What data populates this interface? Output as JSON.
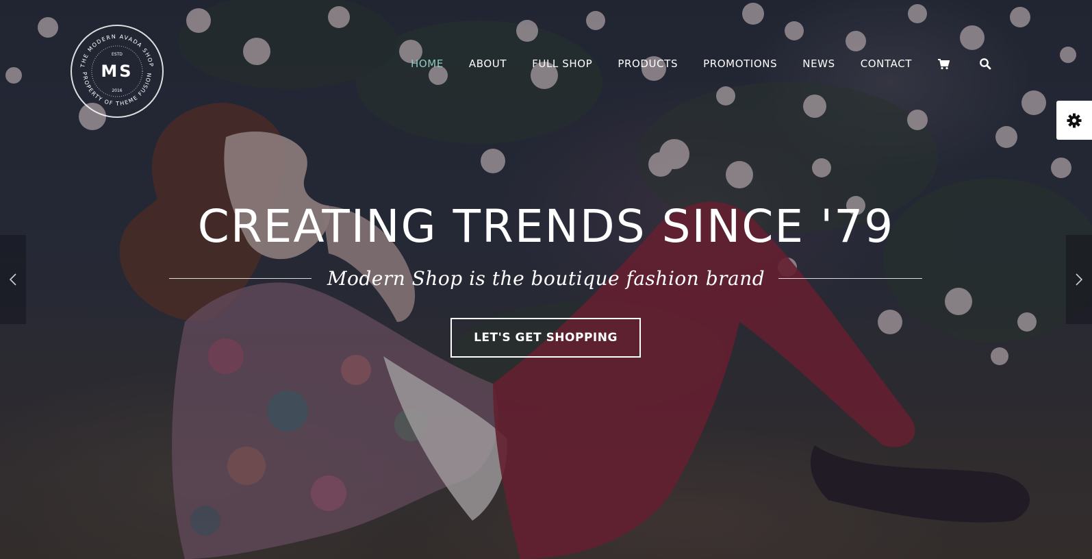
{
  "brand": {
    "initials": "MS",
    "ring_text_top": "THE MODERN AVADA SHOP",
    "ring_text_bottom": "PROPERTY OF THEME FUSION",
    "estd_label": "ESTD",
    "year": "2016"
  },
  "nav": {
    "items": [
      {
        "label": "HOME",
        "active": true
      },
      {
        "label": "ABOUT",
        "active": false
      },
      {
        "label": "FULL SHOP",
        "active": false
      },
      {
        "label": "PRODUCTS",
        "active": false
      },
      {
        "label": "PROMOTIONS",
        "active": false
      },
      {
        "label": "NEWS",
        "active": false
      },
      {
        "label": "CONTACT",
        "active": false
      }
    ],
    "icons": [
      "cart-icon",
      "search-icon"
    ]
  },
  "hero": {
    "headline": "CREATING TRENDS SINCE '79",
    "subtitle": "Modern Shop is the boutique fashion brand",
    "cta_label": "LET'S GET SHOPPING"
  },
  "colors": {
    "active_nav": "#8fc9c0",
    "text": "#ffffff"
  }
}
